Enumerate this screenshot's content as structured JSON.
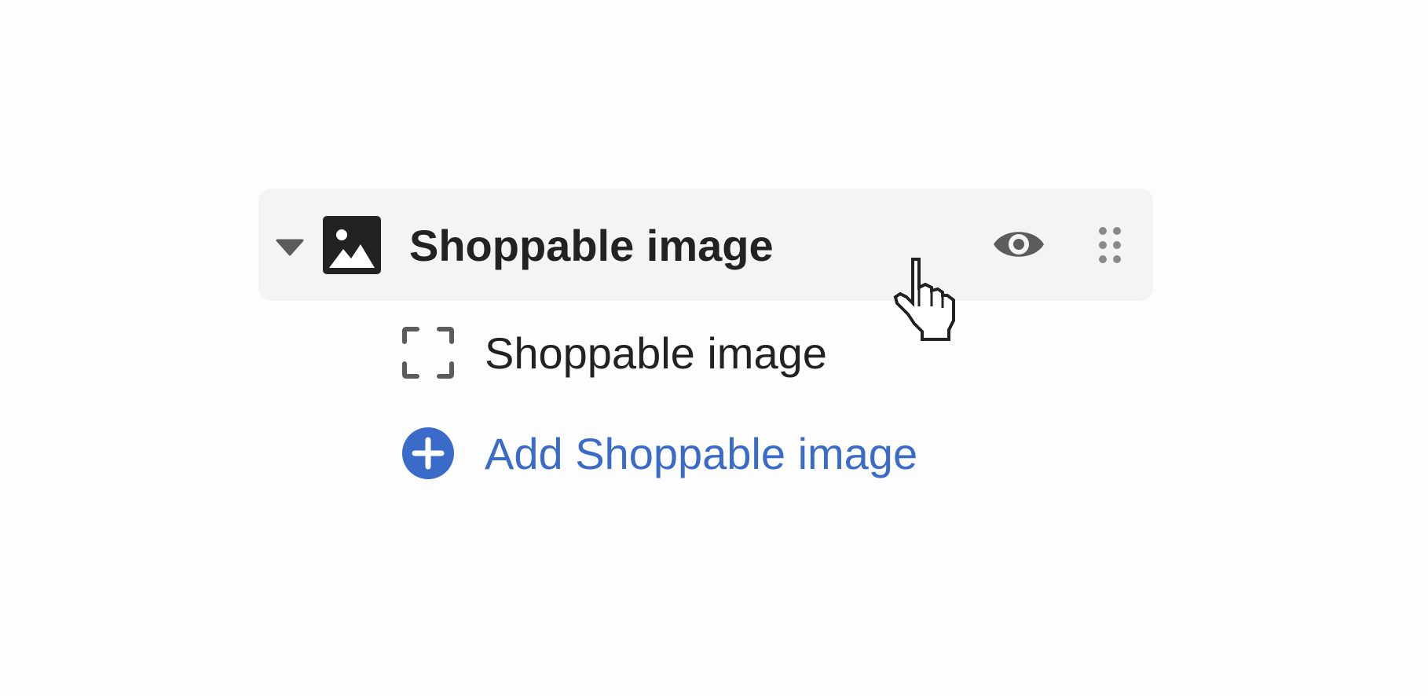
{
  "section": {
    "title": "Shoppable image",
    "icon": "image-icon",
    "expanded": true
  },
  "block": {
    "label": "Shoppable image",
    "icon": "frame-icon"
  },
  "add_block": {
    "label": "Add Shoppable image",
    "icon": "plus-circle-icon"
  },
  "colors": {
    "header_bg": "#f4f4f4",
    "text": "#222222",
    "icon_gray": "#5c5c5c",
    "link_blue": "#3b6bc8"
  }
}
